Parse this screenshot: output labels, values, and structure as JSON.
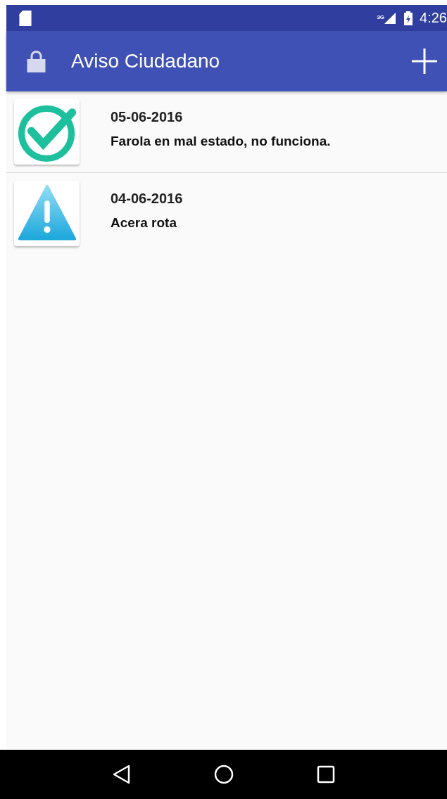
{
  "status_bar": {
    "network": "3G",
    "time": "4:26"
  },
  "app_bar": {
    "title": "Aviso Ciudadano"
  },
  "reports": [
    {
      "kind": "resolved",
      "date": "05-06-2016",
      "description": "Farola en mal estado, no funciona."
    },
    {
      "kind": "warning",
      "date": "04-06-2016",
      "description": "Acera rota"
    }
  ]
}
